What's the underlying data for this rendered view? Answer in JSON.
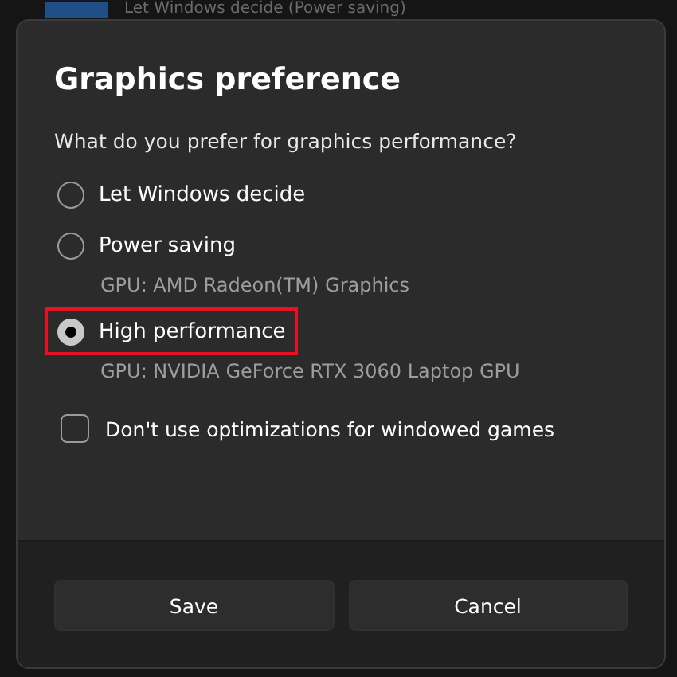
{
  "background": {
    "text": "Let Windows decide (Power saving)"
  },
  "dialog": {
    "title": "Graphics preference",
    "question": "What do you prefer for graphics performance?",
    "options": [
      {
        "label": "Let Windows decide",
        "selected": false,
        "highlighted": false
      },
      {
        "label": "Power saving",
        "selected": false,
        "highlighted": false,
        "detail": "GPU: AMD Radeon(TM) Graphics"
      },
      {
        "label": "High performance",
        "selected": true,
        "highlighted": true,
        "detail": "GPU: NVIDIA GeForce RTX 3060 Laptop GPU"
      }
    ],
    "checkbox": {
      "label": "Don't use optimizations for windowed games",
      "checked": false
    },
    "buttons": [
      "Save",
      "Cancel"
    ]
  }
}
